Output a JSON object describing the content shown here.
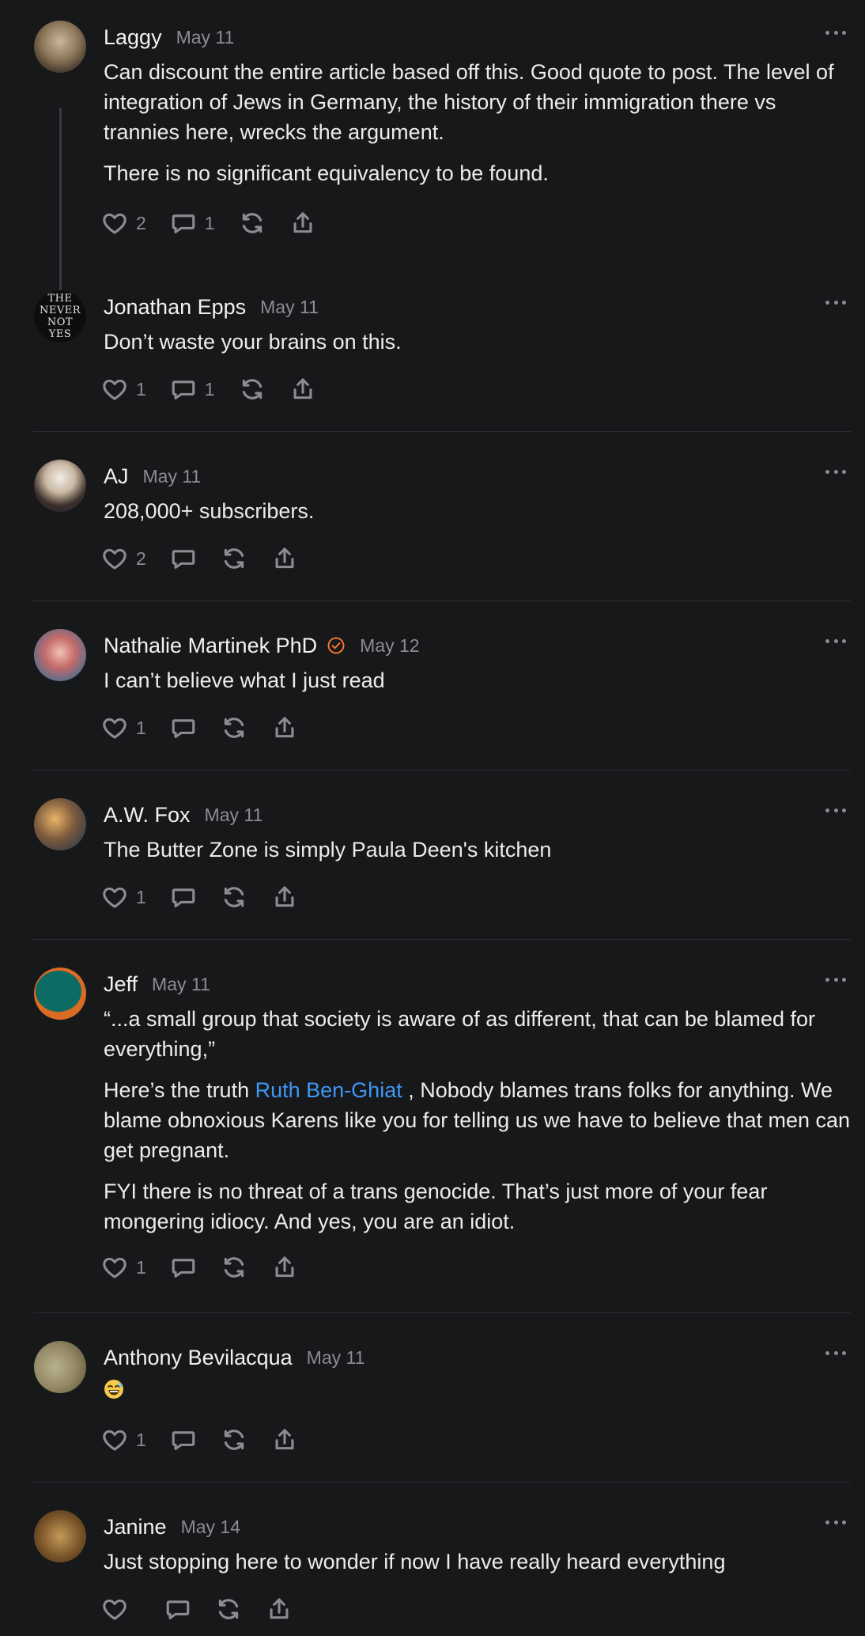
{
  "comments": [
    {
      "name": "Laggy",
      "date": "May 11",
      "paragraphs": [
        "Can discount the entire article based off this. Good quote to post. The level of integration of Jews in Germany, the history of their immigration there vs trannies here, wrecks the argument.",
        "There is no significant equivalency to be found."
      ],
      "likes": "2",
      "replies": "1"
    },
    {
      "name": "Jonathan Epps",
      "date": "May 11",
      "avatar_text": "THE\nNEVER\nNOT\nYES",
      "paragraphs": [
        "Don’t waste your brains on this."
      ],
      "likes": "1",
      "replies": "1"
    },
    {
      "name": "AJ",
      "date": "May 11",
      "paragraphs": [
        "208,000+ subscribers."
      ],
      "likes": "2",
      "replies": ""
    },
    {
      "name": "Nathalie Martinek PhD",
      "date": "May 12",
      "verified_icon": "verified-check-icon",
      "paragraphs": [
        "I can’t believe what I just read"
      ],
      "likes": "1",
      "replies": ""
    },
    {
      "name": "A.W. Fox",
      "date": "May 11",
      "paragraphs": [
        "The Butter Zone is simply Paula Deen's kitchen"
      ],
      "likes": "1",
      "replies": ""
    },
    {
      "name": "Jeff",
      "date": "May 11",
      "paragraphs": [
        "“...a small group that society is aware of as different, that can be blamed for everything,”",
        {
          "before": "Here’s the truth ",
          "mention": "Ruth Ben-Ghiat",
          "after": " , Nobody blames trans folks for anything. We blame obnoxious Karens like you for telling us we have to believe that men can get pregnant."
        },
        "FYI there is no threat of a trans genocide. That’s just more of your fear mongering idiocy. And yes, you are an idiot."
      ],
      "likes": "1",
      "replies": ""
    },
    {
      "name": "Anthony Bevilacqua",
      "date": "May 11",
      "paragraphs": [],
      "emoji": "grinning-sweat-emoji",
      "likes": "1",
      "replies": ""
    },
    {
      "name": "Janine",
      "date": "May 14",
      "paragraphs": [
        "Just stopping here to wonder if now I have really heard everything"
      ],
      "likes": "",
      "replies": ""
    }
  ],
  "icons": {
    "like": "heart-icon",
    "reply": "comment-bubble-icon",
    "restack": "restack-icon",
    "share": "share-icon",
    "more": "more-options-icon"
  },
  "colors": {
    "background": "#17181a",
    "mention": "#3f96f5",
    "verified": "#f5762b",
    "muted": "#8c8d91"
  }
}
